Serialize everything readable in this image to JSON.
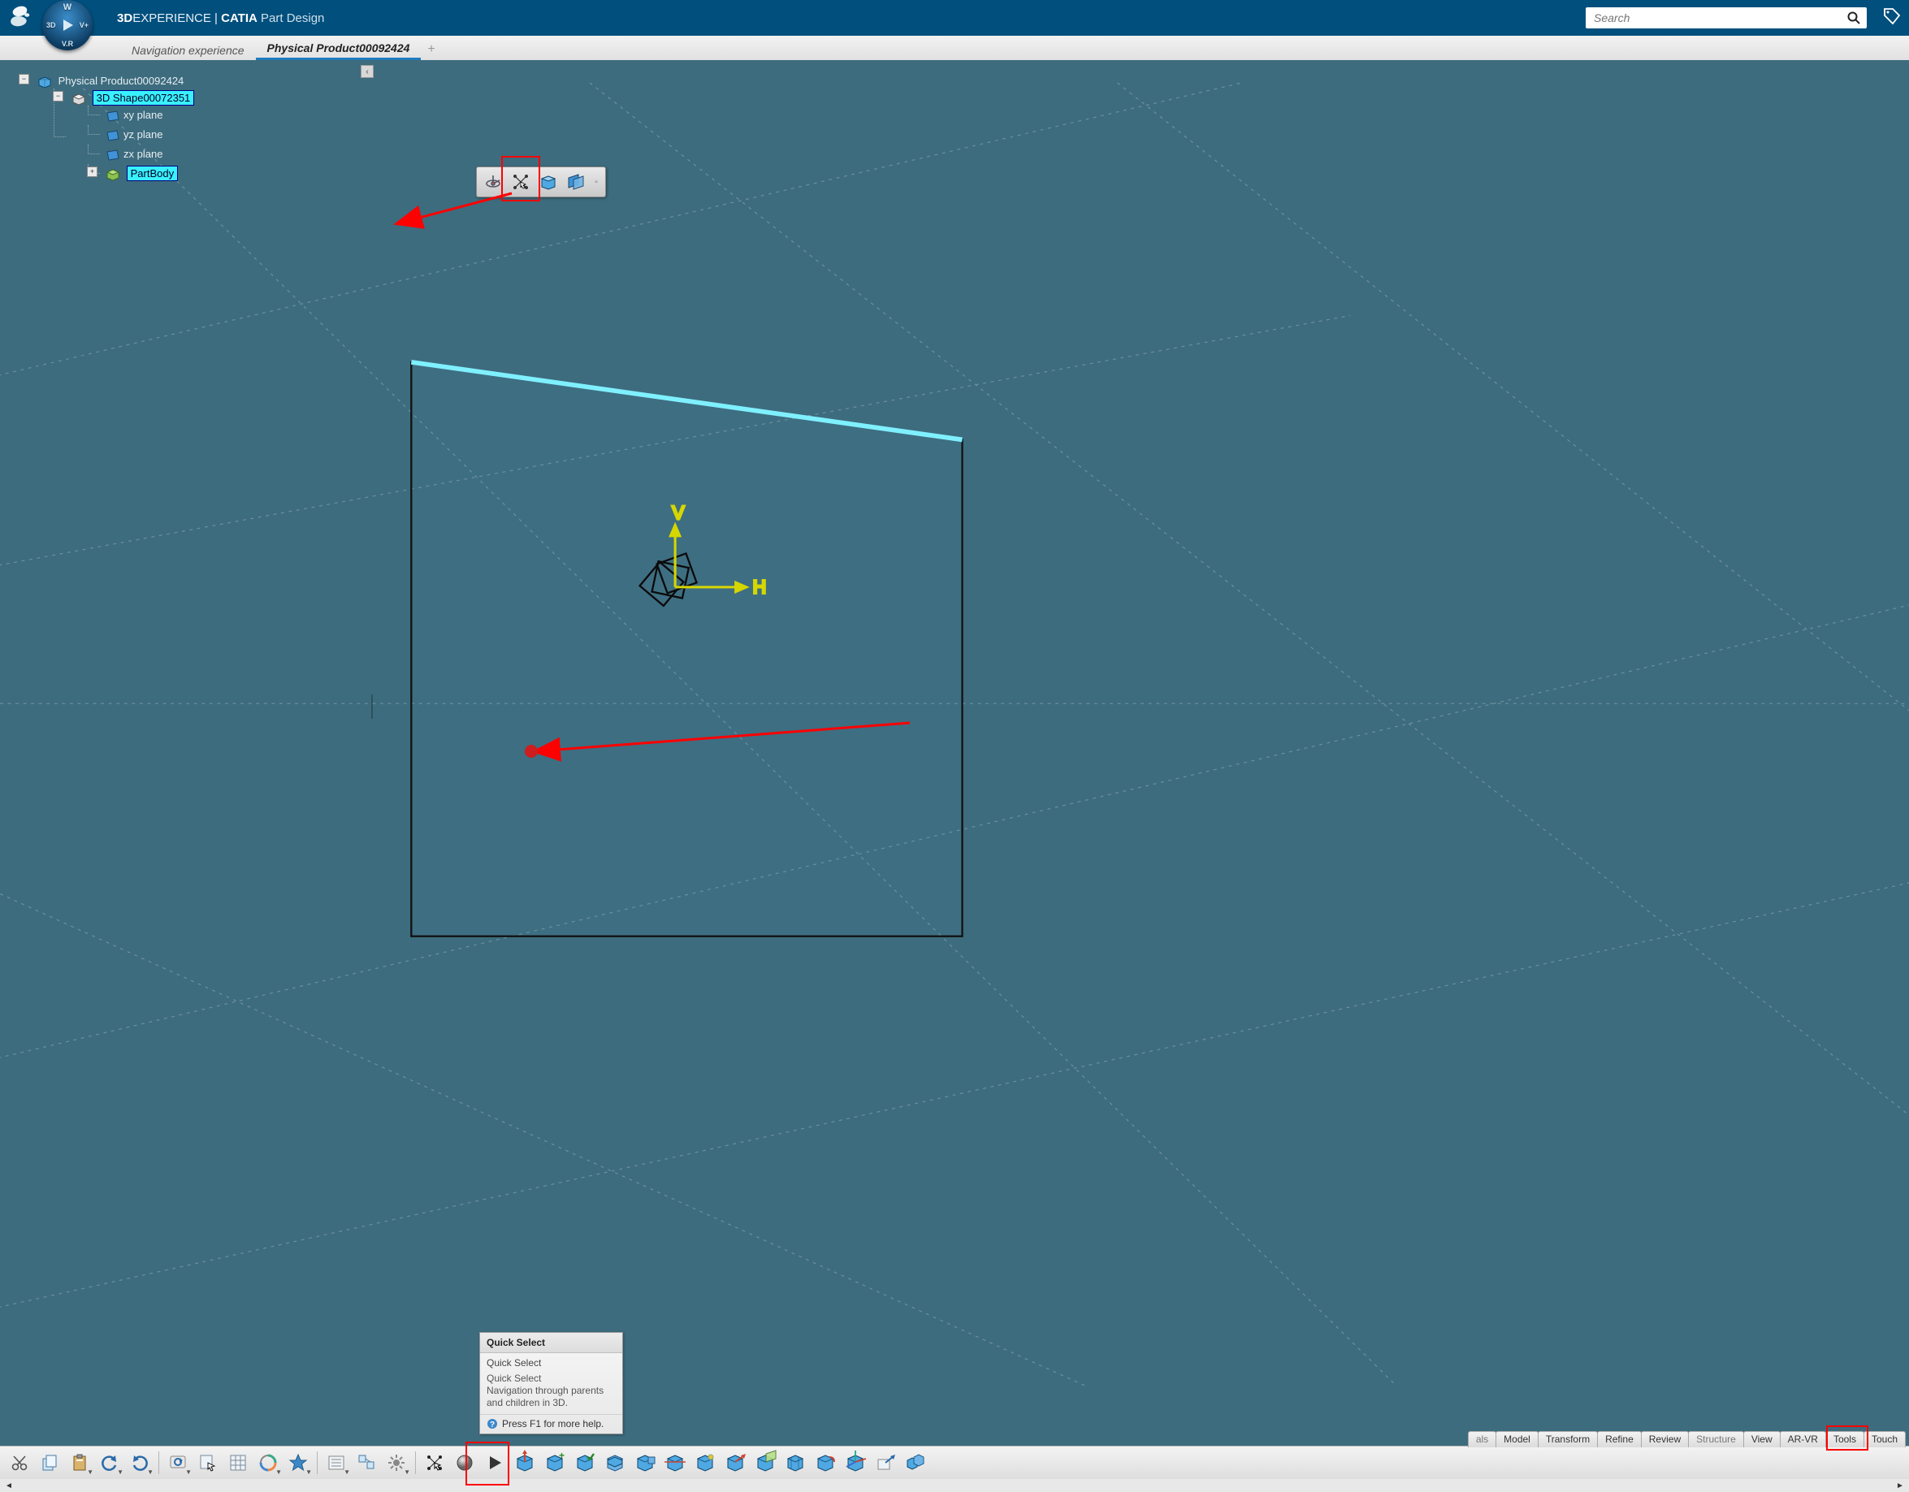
{
  "colors": {
    "brand": "#004f7d",
    "viewport": "#3d6c7e",
    "accent": "#1f7bbf",
    "highlight_red": "#ff0000",
    "selection": "#39f0ff"
  },
  "header": {
    "title_bold": "3D",
    "title_rest": "EXPERIENCE",
    "title_sep": " | ",
    "title_app_bold": "CATIA",
    "title_app_thin": " Part Design",
    "compass": {
      "n": "W",
      "s": "V.R",
      "w": "3D",
      "e": "V+"
    },
    "search_placeholder": "Search"
  },
  "tabs": {
    "items": [
      "Navigation experience",
      "Physical Product00092424"
    ],
    "active_index": 1
  },
  "tree": {
    "root": {
      "label": "Physical Product00092424",
      "expanded": true
    },
    "shape": {
      "label": "3D Shape00072351",
      "expanded": true,
      "selected": true
    },
    "planes": [
      "xy plane",
      "yz plane",
      "zx plane"
    ],
    "body": {
      "label": "PartBody",
      "selected": true,
      "expanded": false
    }
  },
  "context_toolbar": {
    "buttons": [
      "robot-icon",
      "quick-select-icon",
      "sketch-face-icon",
      "offset-plane-icon"
    ],
    "highlight_index": 1
  },
  "tooltip": {
    "title": "Quick Select",
    "subtitle": "Quick Select",
    "desc_title": "Quick Select",
    "desc": "Navigation through parents and children in 3D.",
    "help": "Press F1 for more help."
  },
  "ribbon_tabs": [
    "als",
    "Model",
    "Transform",
    "Refine",
    "Review",
    "Structure",
    "View",
    "AR-VR",
    "Tools",
    "Touch"
  ],
  "ribbon_highlight_index": 8,
  "bottom_toolbar": [
    {
      "name": "cut-icon",
      "dd": false
    },
    {
      "name": "copy-icon",
      "dd": false
    },
    {
      "name": "paste-icon",
      "dd": true
    },
    {
      "name": "undo-icon",
      "dd": true
    },
    {
      "name": "redo-icon",
      "dd": true
    },
    {
      "name": "sep"
    },
    {
      "name": "update-icon",
      "dd": true
    },
    {
      "name": "select-under-icon",
      "dd": false
    },
    {
      "name": "grid-display-icon",
      "dd": false
    },
    {
      "name": "axis-system-icon",
      "dd": true
    },
    {
      "name": "favorite-icon",
      "dd": true
    },
    {
      "name": "sep"
    },
    {
      "name": "list-icon",
      "dd": true
    },
    {
      "name": "tree-reframe-icon",
      "dd": false
    },
    {
      "name": "settings-icon",
      "dd": true
    },
    {
      "name": "sep"
    },
    {
      "name": "quick-select-icon",
      "dd": false,
      "highlight": true
    },
    {
      "name": "sphere-icon",
      "dd": false
    },
    {
      "name": "play-icon",
      "dd": false
    },
    {
      "name": "pad-icon",
      "dd": false
    },
    {
      "name": "pad-plus-icon",
      "dd": false
    },
    {
      "name": "shell-check-icon",
      "dd": false
    },
    {
      "name": "box-stack-icon",
      "dd": false
    },
    {
      "name": "box-row-icon",
      "dd": false
    },
    {
      "name": "box-slide-icon",
      "dd": false
    },
    {
      "name": "box-dot-icon",
      "dd": false
    },
    {
      "name": "box-arrow-icon",
      "dd": false
    },
    {
      "name": "box-plane-icon",
      "dd": false
    },
    {
      "name": "box-grid-icon",
      "dd": false
    },
    {
      "name": "box-link-icon",
      "dd": false
    },
    {
      "name": "box-axis-icon",
      "dd": false
    },
    {
      "name": "export-icon",
      "dd": false
    },
    {
      "name": "multi-box-icon",
      "dd": false
    }
  ],
  "axis": {
    "v": "V",
    "h": "H"
  }
}
